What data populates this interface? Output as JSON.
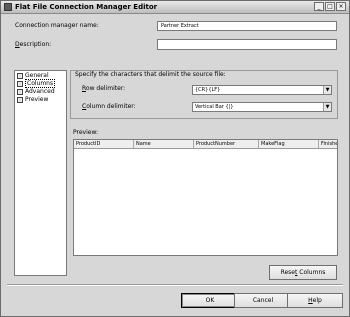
{
  "window": {
    "title": "Flat File Connection Manager Editor"
  },
  "titlebar_buttons": {
    "minimize": "_",
    "maximize": "□",
    "close": "×"
  },
  "connection_name": {
    "label_pre": "",
    "label_key": "",
    "label_full": "Connection manager name:",
    "value": "Partner Extract"
  },
  "description": {
    "label_key": "D",
    "label_rest": "escription:",
    "value": ""
  },
  "nav": {
    "items": [
      {
        "label": "General"
      },
      {
        "label": "Columns"
      },
      {
        "label": "Advanced"
      },
      {
        "label": "Preview"
      }
    ]
  },
  "delimiters": {
    "group_label": "Specify the characters that delimit the source file:",
    "row": {
      "label_key": "R",
      "label_rest": "ow delimiter:",
      "value": "{CR}{LF}"
    },
    "column": {
      "label_key": "C",
      "label_rest": "olumn delimiter:",
      "value": "Vertical Bar {|}"
    }
  },
  "preview": {
    "label": "Preview:",
    "columns": [
      "ProductID",
      "Name",
      "ProductNumber",
      "MakeFlag",
      "Finishe"
    ]
  },
  "buttons": {
    "reset_key": "t",
    "reset_pre": "Rese",
    "reset_post": " Columns",
    "ok": "OK",
    "cancel": "Cancel",
    "help_key": "H",
    "help_rest": "elp"
  }
}
